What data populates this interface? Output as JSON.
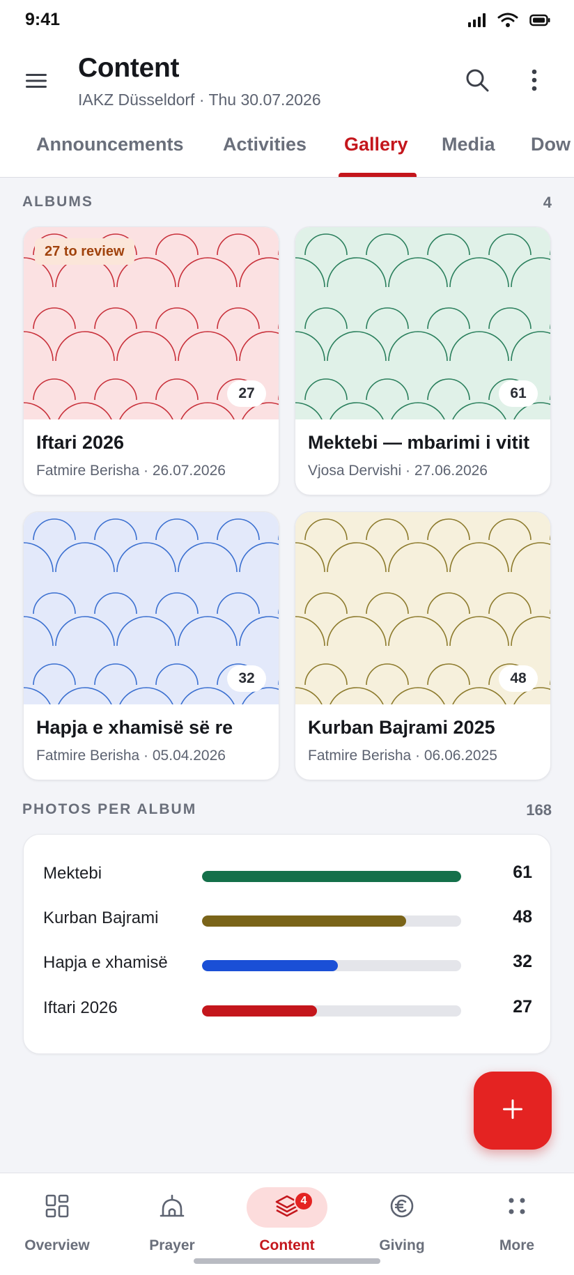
{
  "status_bar": {
    "time": "9:41"
  },
  "header": {
    "title": "Content",
    "subtitle": "IAKZ Düsseldorf · Thu 30.07.2026"
  },
  "tabs": [
    {
      "label": "Announcements",
      "active": false
    },
    {
      "label": "Activities",
      "active": false
    },
    {
      "label": "Gallery",
      "active": true
    },
    {
      "label": "Media",
      "active": false
    },
    {
      "label": "Dow",
      "active": false
    }
  ],
  "albums_section": {
    "label": "ALBUMS",
    "count": "4"
  },
  "albums": [
    {
      "title": "Iftari 2026",
      "meta": "Fatmire Berisha · 26.07.2026",
      "photos": "27",
      "review_badge": "27 to review",
      "bg": "#fbe1e2",
      "stroke": "#c8303a"
    },
    {
      "title": "Mektebi — mbarimi i vitit",
      "meta": "Vjosa Dervishi · 27.06.2026",
      "photos": "61",
      "review_badge": "",
      "bg": "#e0f1e8",
      "stroke": "#2a7f5c"
    },
    {
      "title": "Hapja e xhamisë së re",
      "meta": "Fatmire Berisha · 05.04.2026",
      "photos": "32",
      "review_badge": "",
      "bg": "#e3e9fa",
      "stroke": "#3a6fd0"
    },
    {
      "title": "Kurban Bajrami 2025",
      "meta": "Fatmire Berisha · 06.06.2025",
      "photos": "48",
      "review_badge": "",
      "bg": "#f6f0dc",
      "stroke": "#8c7a2c"
    }
  ],
  "photos_section": {
    "label": "PHOTOS PER ALBUM",
    "total": "168"
  },
  "photo_stats": [
    {
      "label": "Mektebi",
      "value": 61,
      "value_text": "61",
      "color": "#14704a"
    },
    {
      "label": "Kurban Bajrami",
      "value": 48,
      "value_text": "48",
      "color": "#7a6419"
    },
    {
      "label": "Hapja e xhamisë",
      "value": 32,
      "value_text": "32",
      "color": "#1a4fd6"
    },
    {
      "label": "Iftari 2026",
      "value": 27,
      "value_text": "27",
      "color": "#c4161c"
    }
  ],
  "fab": {
    "icon": "plus-icon"
  },
  "bottom_nav": [
    {
      "label": "Overview",
      "icon": "grid-icon",
      "active": false
    },
    {
      "label": "Prayer",
      "icon": "mosque-icon",
      "active": false
    },
    {
      "label": "Content",
      "icon": "layers-icon",
      "active": true,
      "badge": "4"
    },
    {
      "label": "Giving",
      "icon": "euro-icon",
      "active": false
    },
    {
      "label": "More",
      "icon": "dots-grid-icon",
      "active": false
    }
  ],
  "colors": {
    "accent": "#c4161c",
    "fab": "#e42322"
  }
}
